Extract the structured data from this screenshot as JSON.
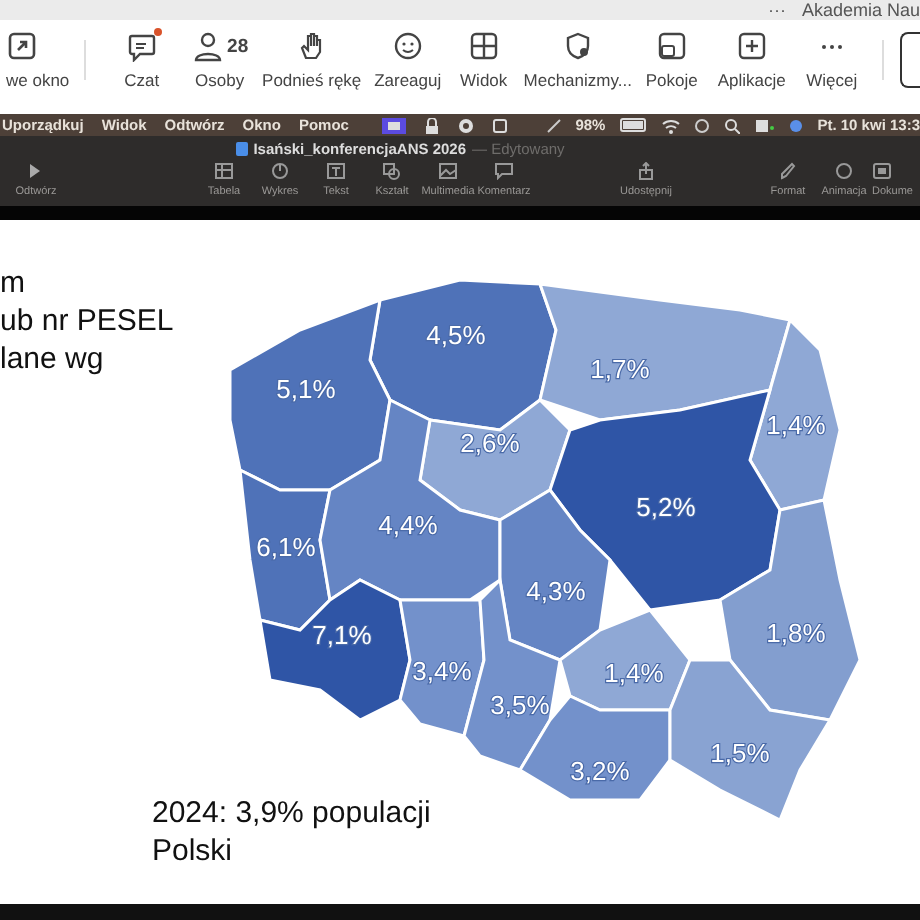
{
  "top_strip": {
    "more": "···",
    "title": "Akademia Nau"
  },
  "meeting_toolbar": {
    "items": [
      {
        "label": "we okno"
      },
      {
        "label": "Czat",
        "unread": true
      },
      {
        "label": "Osoby",
        "count": "28"
      },
      {
        "label": "Podnieś rękę"
      },
      {
        "label": "Zareaguj"
      },
      {
        "label": "Widok"
      },
      {
        "label": "Mechanizmy..."
      },
      {
        "label": "Pokoje"
      },
      {
        "label": "Aplikacje"
      },
      {
        "label": "Więcej"
      }
    ]
  },
  "menu_bar": {
    "menus": [
      "Uporządkuj",
      "Widok",
      "Odtwórz",
      "Okno",
      "Pomoc"
    ],
    "battery": "98%",
    "clock": "Pt. 10 kwi 13:3"
  },
  "keynote": {
    "document": "Isański_konferencjaANS 2026",
    "status": "— Edytowany",
    "buttons": [
      {
        "label": "Odtwórz"
      },
      {
        "label": "Tabela"
      },
      {
        "label": "Wykres"
      },
      {
        "label": "Tekst"
      },
      {
        "label": "Kształt"
      },
      {
        "label": "Multimedia"
      },
      {
        "label": "Komentarz"
      },
      {
        "label": "Udostępnij"
      },
      {
        "label": "Format"
      },
      {
        "label": "Animacja"
      },
      {
        "label": "Dokume"
      }
    ]
  },
  "slide": {
    "text_lines": [
      "m",
      "ub nr PESEL",
      "lane wg"
    ],
    "regions": [
      {
        "value": "4,5%",
        "color": "#4f72b8"
      },
      {
        "value": "5,1%",
        "color": "#4f72b8"
      },
      {
        "value": "1,7%",
        "color": "#8fa8d5"
      },
      {
        "value": "1,4%",
        "color": "#8fa8d5"
      },
      {
        "value": "2,6%",
        "color": "#8fa8d5"
      },
      {
        "value": "5,2%",
        "color": "#2f55a6"
      },
      {
        "value": "6,1%",
        "color": "#4f72b8"
      },
      {
        "value": "4,4%",
        "color": "#6585c4"
      },
      {
        "value": "4,3%",
        "color": "#6585c4"
      },
      {
        "value": "1,8%",
        "color": "#839ecf"
      },
      {
        "value": "7,1%",
        "color": "#2f55a6"
      },
      {
        "value": "3,4%",
        "color": "#7391cb"
      },
      {
        "value": "3,5%",
        "color": "#7391cb"
      },
      {
        "value": "1,4%",
        "color": "#8fa8d5"
      },
      {
        "value": "3,2%",
        "color": "#7391cb"
      },
      {
        "value": "1,5%",
        "color": "#89a3d2"
      }
    ],
    "caption": [
      "2024: 3,9% populacji",
      "Polski"
    ]
  }
}
